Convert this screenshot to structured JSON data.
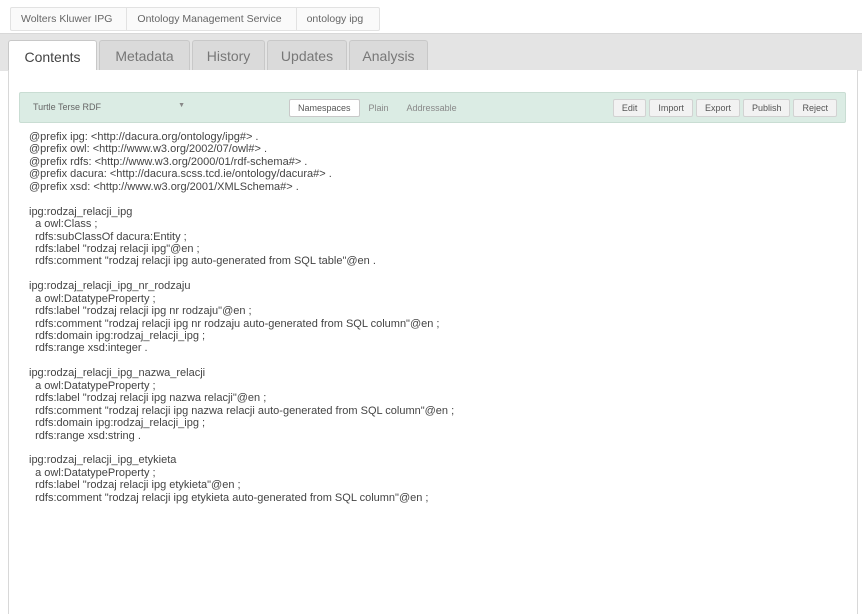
{
  "breadcrumb": [
    "Wolters Kluwer IPG",
    "Ontology Management Service",
    "ontology ipg"
  ],
  "tabs": [
    "Contents",
    "Metadata",
    "History",
    "Updates",
    "Analysis"
  ],
  "toolbar": {
    "format": "Turtle Terse RDF",
    "modes": [
      "Namespaces",
      "Plain",
      "Addressable"
    ],
    "actions": [
      "Edit",
      "Import",
      "Export",
      "Publish",
      "Reject"
    ]
  },
  "code_lines": [
    "@prefix ipg: <http://dacura.org/ontology/ipg#> .",
    "@prefix owl: <http://www.w3.org/2002/07/owl#> .",
    "@prefix rdfs: <http://www.w3.org/2000/01/rdf-schema#> .",
    "@prefix dacura: <http://dacura.scss.tcd.ie/ontology/dacura#> .",
    "@prefix xsd: <http://www.w3.org/2001/XMLSchema#> .",
    "",
    "ipg:rodzaj_relacji_ipg",
    "  a owl:Class ;",
    "  rdfs:subClassOf dacura:Entity ;",
    "  rdfs:label \"rodzaj relacji ipg\"@en ;",
    "  rdfs:comment \"rodzaj relacji ipg auto-generated from SQL table\"@en .",
    "",
    "ipg:rodzaj_relacji_ipg_nr_rodzaju",
    "  a owl:DatatypeProperty ;",
    "  rdfs:label \"rodzaj relacji ipg nr rodzaju\"@en ;",
    "  rdfs:comment \"rodzaj relacji ipg nr rodzaju auto-generated from SQL column\"@en ;",
    "  rdfs:domain ipg:rodzaj_relacji_ipg ;",
    "  rdfs:range xsd:integer .",
    "",
    "ipg:rodzaj_relacji_ipg_nazwa_relacji",
    "  a owl:DatatypeProperty ;",
    "  rdfs:label \"rodzaj relacji ipg nazwa relacji\"@en ;",
    "  rdfs:comment \"rodzaj relacji ipg nazwa relacji auto-generated from SQL column\"@en ;",
    "  rdfs:domain ipg:rodzaj_relacji_ipg ;",
    "  rdfs:range xsd:string .",
    "",
    "ipg:rodzaj_relacji_ipg_etykieta",
    "  a owl:DatatypeProperty ;",
    "  rdfs:label \"rodzaj relacji ipg etykieta\"@en ;",
    "  rdfs:comment \"rodzaj relacji ipg etykieta auto-generated from SQL column\"@en ;"
  ]
}
